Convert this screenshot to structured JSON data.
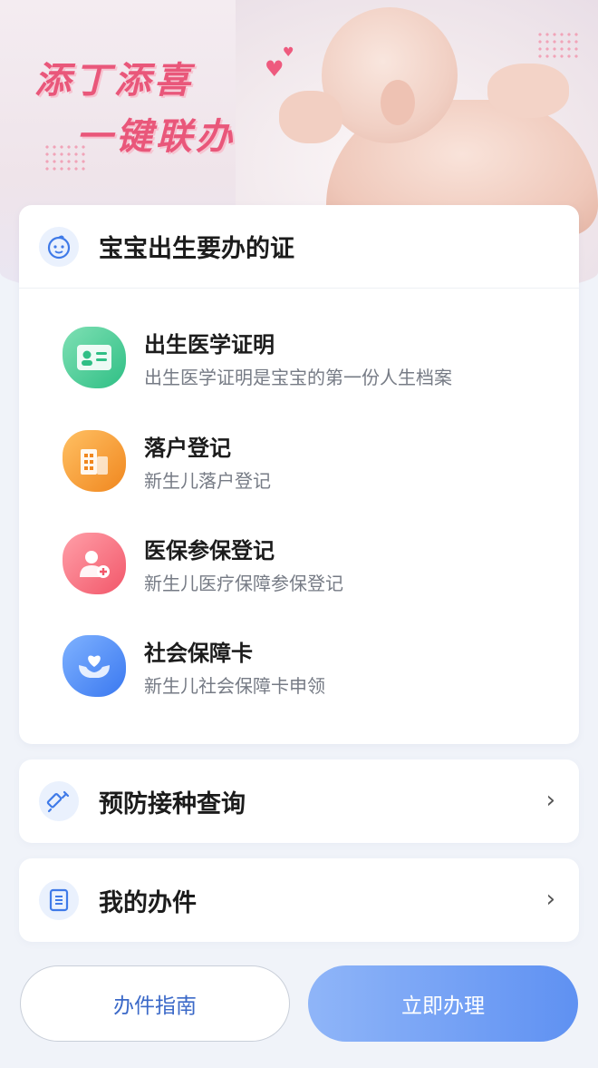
{
  "banner": {
    "title_line1": "添丁添喜",
    "title_line2": "一键联办"
  },
  "card": {
    "title": "宝宝出生要办的证",
    "items": [
      {
        "name": "出生医学证明",
        "desc": "出生医学证明是宝宝的第一份人生档案",
        "icon": "id-card-icon",
        "color": "#2fbf85"
      },
      {
        "name": "落户登记",
        "desc": "新生儿落户登记",
        "icon": "building-icon",
        "color": "#f0871f"
      },
      {
        "name": "医保参保登记",
        "desc": "新生儿医疗保障参保登记",
        "icon": "user-plus-icon",
        "color": "#f2576a"
      },
      {
        "name": "社会保障卡",
        "desc": "新生儿社会保障卡申领",
        "icon": "heart-hands-icon",
        "color": "#3a78f0"
      }
    ]
  },
  "rows": {
    "vaccination": "预防接种查询",
    "my_cases": "我的办件"
  },
  "buttons": {
    "guide": "办件指南",
    "apply": "立即办理"
  }
}
